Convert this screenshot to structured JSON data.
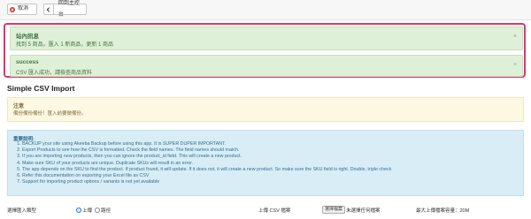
{
  "toolbar": {
    "cancel_label": "取消",
    "back_label": "回到主控台"
  },
  "messages": [
    {
      "title": "站內訊息",
      "text": "找到 5 商品，匯入 1 新商品，更新 1 商品"
    },
    {
      "title": "success",
      "text": "CSV 匯入成功，請檢查商品資料"
    }
  ],
  "close_symbol": "×",
  "page_title": "Simple CSV Import",
  "warning": {
    "title": "注意",
    "text": "備份備份備份！匯入前要做備份。"
  },
  "info": {
    "title": "重要說明:",
    "items": [
      "BACKUP your site using Akeeba Backup before using this app. It is SUPER DUPER IMPORTANT.",
      "Export Products to see how the CSV is formatted. Check the field names. The field names should match.",
      "If you are importing new products, then you can ignore the product_id field. This will create a new product.",
      "Make sure SKU of your products are unique. Duplicate SKUs will result in an error.",
      "The app depends on the SKU to find the product. If product found, it will update. If it does not, it will create a new product. So make sure the SKU field is right. Double, triple check",
      "Refer this documentation on exporting your Excel file as CSV",
      "Support for importing product options / variants is not yet available"
    ]
  },
  "form": {
    "import_type_label": "選擇匯入類型",
    "option_upload": "上傳",
    "option_path": "路徑",
    "csv_file_label": "上傳 CSV 檔案",
    "choose_file_label": "選擇檔案",
    "no_file_label": "未選擇任何檔案",
    "max_size_label": "最大上傳檔案容量：20M"
  },
  "colors": {
    "highlight": "#e0356b",
    "success_bg": "#dff0d8",
    "warning_bg": "#fcf8e3",
    "info_bg": "#d9edf7"
  }
}
